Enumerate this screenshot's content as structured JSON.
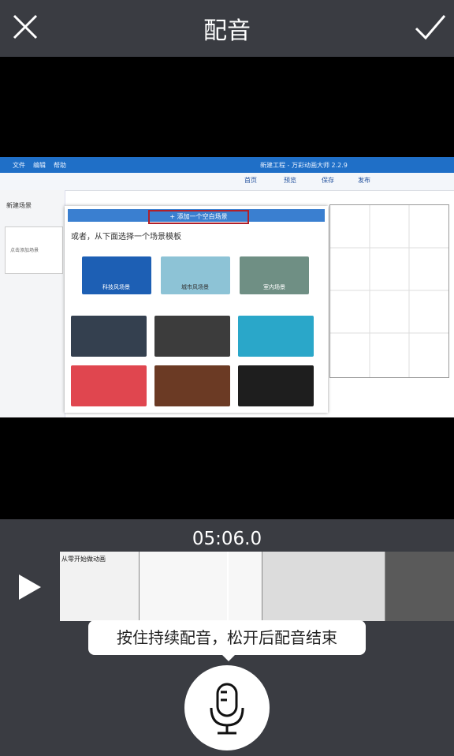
{
  "header": {
    "title": "配音",
    "close_icon": "close-icon",
    "confirm_icon": "checkmark-icon"
  },
  "preview": {
    "app_menu": [
      "文件",
      "编辑",
      "帮助"
    ],
    "app_title": "新建工程 - 万彩动画大师 2.2.9",
    "toolbar": [
      "首页",
      "预览",
      "保存",
      "发布"
    ],
    "new_scene_label": "新建场景",
    "add_scene_button": "添加一个空白场景",
    "template_prompt": "或者，从下面选择一个场景模板",
    "template_labels": [
      "科技风场景",
      "城市风场景",
      "室内场景"
    ],
    "scene_thumb_caption": "点击添加场景"
  },
  "timeline": {
    "time": "05:06.0",
    "play_icon": "play-icon",
    "tooltip": "按住持续配音，松开后配音结束",
    "record_icon": "microphone-icon",
    "thumb_text": "从零开始做动画"
  }
}
